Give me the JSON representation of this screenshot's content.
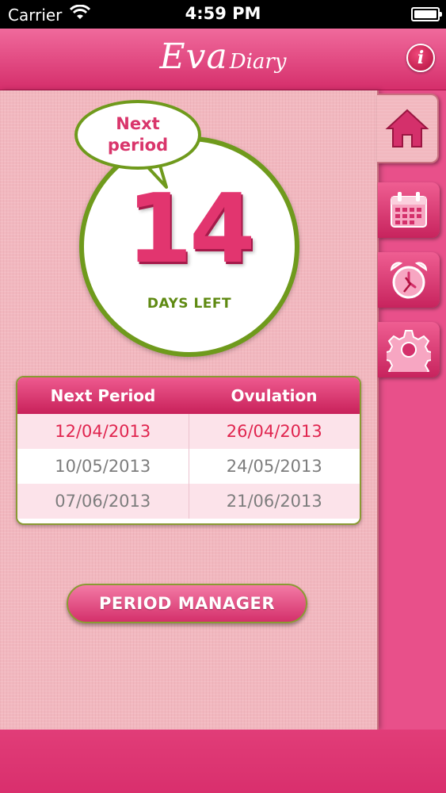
{
  "status_bar": {
    "carrier": "Carrier",
    "time": "4:59 PM"
  },
  "header": {
    "logo_main": "Eva",
    "logo_sub": "Diary",
    "info_label": "i"
  },
  "counter": {
    "bubble_line1": "Next",
    "bubble_line2": "period",
    "days": "14",
    "days_label": "DAYS LEFT"
  },
  "table": {
    "headers": [
      "Next Period",
      "Ovulation"
    ],
    "rows": [
      [
        "12/04/2013",
        "26/04/2013"
      ],
      [
        "10/05/2013",
        "24/05/2013"
      ],
      [
        "07/06/2013",
        "21/06/2013"
      ]
    ]
  },
  "actions": {
    "period_manager": "PERIOD MANAGER"
  },
  "tabs": {
    "home": "home-icon",
    "calendar": "calendar-icon",
    "alarm": "alarm-clock-icon",
    "settings": "gear-icon"
  },
  "colors": {
    "accent": "#e2356f",
    "green": "#6f9a1c",
    "highlight": "#e0254f"
  }
}
